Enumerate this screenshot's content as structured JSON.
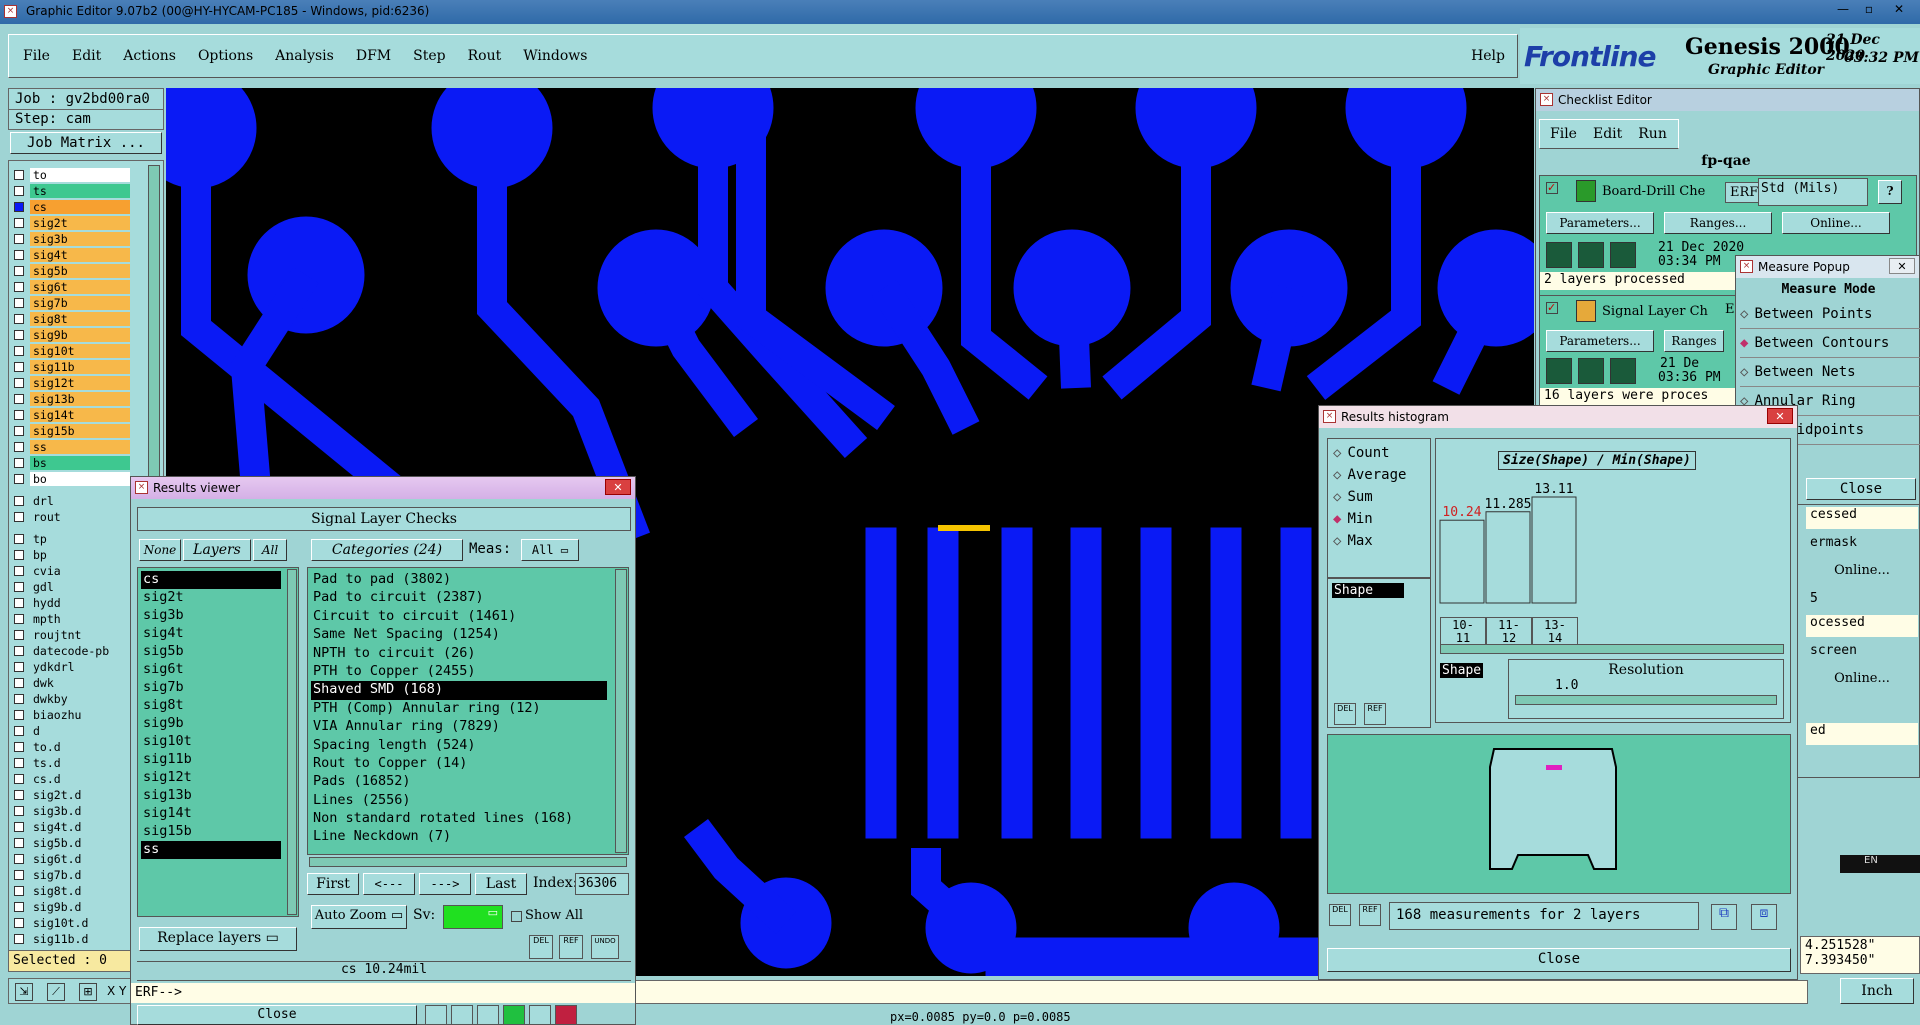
{
  "titlebar": {
    "text": "Graphic Editor 9.07b2 (00@HY-HYCAM-PC185 - Windows, pid:6236)"
  },
  "menu": [
    "File",
    "Edit",
    "Actions",
    "Options",
    "Analysis",
    "DFM",
    "Step",
    "Rout",
    "Windows"
  ],
  "help": "Help",
  "brand": {
    "logo": "Frontline",
    "product": "Genesis 2000",
    "sub": "Graphic Editor",
    "date": "21 Dec 2020",
    "time": "03:32 PM"
  },
  "job": {
    "job": "Job : gv2bd00ra0",
    "step": "Step: cam",
    "matrix": "Job Matrix ..."
  },
  "layers": [
    "to",
    "ts",
    "cs",
    "sig2t",
    "sig3b",
    "sig4t",
    "sig5b",
    "sig6t",
    "sig7b",
    "sig8t",
    "sig9b",
    "sig10t",
    "sig11b",
    "sig12t",
    "sig13b",
    "sig14t",
    "sig15b",
    "ss",
    "bs",
    "bo"
  ],
  "layers2": [
    "drl",
    "rout"
  ],
  "layers3": [
    "tp",
    "bp",
    "cvia",
    "gdl",
    "hydd",
    "mpth",
    "roujtnt",
    "datecode-pb",
    "ydkdrl",
    "dwk",
    "dwkby",
    "biaozhu",
    "d",
    "to.d",
    "ts.d",
    "cs.d",
    "sig2t.d",
    "sig3b.d",
    "sig4t.d",
    "sig5b.d",
    "sig6t.d",
    "sig7b.d",
    "sig8t.d",
    "sig9b.d",
    "sig10t.d",
    "sig11b.d"
  ],
  "selected": "Selected : 0",
  "checklist": {
    "title": "Checklist Editor",
    "menu": [
      "File",
      "Edit",
      "Run"
    ],
    "name": "fp-qae",
    "item1": {
      "name": "Board-Drill Che",
      "erf": "ERF:",
      "erfval": "Std (Mils)",
      "date": "21 Dec 2020",
      "time": "03:34 PM",
      "status": "2 layers processed"
    },
    "item2": {
      "name": "Signal Layer Ch",
      "erf": "ER",
      "date": "21 De",
      "time": "03:36 PM",
      "status": "16 layers were proces"
    },
    "params": "Parameters...",
    "ranges": "Ranges...",
    "online": "Online...",
    "partial": [
      "Ranges",
      "cessed",
      "ermask",
      "Online...",
      "5",
      "ocessed",
      "screen",
      "Online...",
      "ed"
    ]
  },
  "measure": {
    "title": "Measure Popup",
    "mode": "Measure Mode",
    "options": [
      "Between Points",
      "Between Contours",
      "Between Nets",
      "Annular Ring",
      "een Midpoints"
    ],
    "close": "Close"
  },
  "hist": {
    "title": "Results histogram",
    "modes": [
      "Count",
      "Average",
      "Sum",
      "Min",
      "Max"
    ],
    "shape": "Shape",
    "heading": "Size(Shape) / Min(Shape)",
    "bars": [
      {
        "label": "10.24",
        "value": 10.24,
        "cat": "10-\n11"
      },
      {
        "label": "11.285",
        "value": 11.285,
        "cat": "11-\n12"
      },
      {
        "label": "13.11",
        "value": 13.11,
        "cat": "13-\n14"
      }
    ],
    "resolution": "Resolution",
    "resval": "1.0",
    "summary": "168 measurements for 2 layers",
    "close": "Close",
    "del": "DEL",
    "ref": "REF"
  },
  "results": {
    "title": "Results viewer",
    "heading": "Signal Layer Checks",
    "none": "None",
    "layers": "Layers",
    "all": "All",
    "categories": "Categories (24)",
    "meas": "Meas:",
    "measval": "All",
    "layerlist": [
      "cs",
      "sig2t",
      "sig3b",
      "sig4t",
      "sig5b",
      "sig6t",
      "sig7b",
      "sig8t",
      "sig9b",
      "sig10t",
      "sig11b",
      "sig12t",
      "sig13b",
      "sig14t",
      "sig15b",
      "ss"
    ],
    "catlist": [
      "Pad to pad (3802)",
      "Pad to circuit (2387)",
      "Circuit to circuit (1461)",
      "Same Net Spacing (1254)",
      "NPTH to circuit (26)",
      "PTH to Copper (2455)",
      "Shaved SMD (168)",
      "PTH (Comp) Annular ring (12)",
      "VIA Annular ring (7829)",
      "Spacing length (524)",
      "Rout to Copper (14)",
      "Pads (16852)",
      "Lines (2556)",
      "Non standard rotated lines (168)",
      "Line Neckdown (7)"
    ],
    "first": "First",
    "prev": "<---",
    "next": "--->",
    "last": "Last",
    "index": "Index:",
    "indexval": "36306",
    "autozoom": "Auto Zoom",
    "sv": "Sv:",
    "showall": "Show All",
    "replace": "Replace layers",
    "status": "cs 10.24mil",
    "close": "Close",
    "del": "DEL",
    "ref": "REF",
    "undo": "UNDO"
  },
  "cmd": {
    "erf": "ERF-->",
    "coords1": "4.251528\"",
    "coords2": "7.393450\"",
    "unit": "Inch",
    "xy": "X Y",
    "bottom": "px=0.0085 py=0.0 p=0.0085",
    "lang": "EN"
  }
}
